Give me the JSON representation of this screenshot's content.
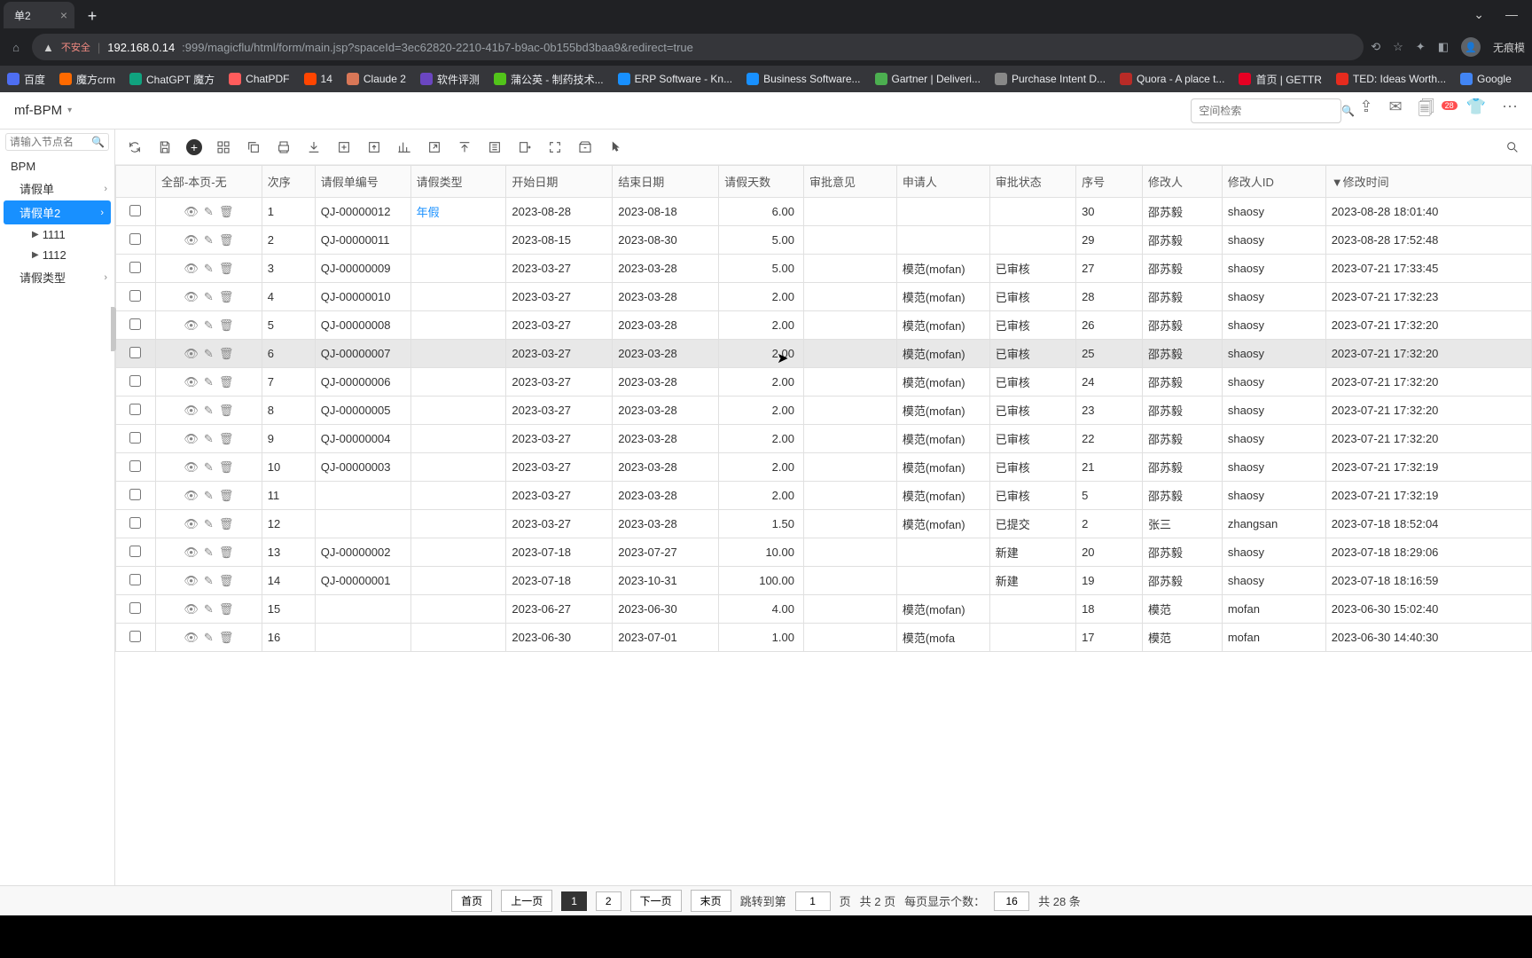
{
  "browser": {
    "tab_title": "单2",
    "url_warning": "不安全",
    "url_host": "192.168.0.14",
    "url_rest": ":999/magicflu/html/form/main.jsp?spaceId=3ec62820-2210-41b7-b9ac-0b155bd3baa9&redirect=true",
    "profile": "无痕模",
    "bookmarks": [
      {
        "label": "百度",
        "color": "#4e6ef2"
      },
      {
        "label": "魔方crm",
        "color": "#ff6a00"
      },
      {
        "label": "ChatGPT 魔方",
        "color": "#10a37f"
      },
      {
        "label": "ChatPDF",
        "color": "#ff5c5c"
      },
      {
        "label": "14",
        "color": "#ff4500"
      },
      {
        "label": "Claude 2",
        "color": "#d97757"
      },
      {
        "label": "软件评测",
        "color": "#6b46c1"
      },
      {
        "label": "蒲公英 - 制药技术...",
        "color": "#52c41a"
      },
      {
        "label": "ERP Software - Kn...",
        "color": "#1890ff"
      },
      {
        "label": "Business Software...",
        "color": "#1890ff"
      },
      {
        "label": "Gartner | Deliveri...",
        "color": "#4caf50"
      },
      {
        "label": "Purchase Intent D...",
        "color": "#888"
      },
      {
        "label": "Quora - A place t...",
        "color": "#b92b27"
      },
      {
        "label": "首页 | GETTR",
        "color": "#e60023"
      },
      {
        "label": "TED: Ideas Worth...",
        "color": "#e62b1e"
      },
      {
        "label": "Google",
        "color": "#4285f4"
      }
    ]
  },
  "app": {
    "title": "mf-BPM",
    "search_placeholder": "空间检索",
    "notif_badge": "28"
  },
  "sidebar": {
    "search_placeholder": "请输入节点名",
    "root": "BPM",
    "nodes": {
      "leave": "请假单",
      "leave2": "请假单2",
      "n1111": "1111",
      "n1112": "1112",
      "leave_type": "请假类型"
    }
  },
  "table": {
    "header": {
      "all": "全部-本页-无",
      "seq": "次序",
      "id": "请假单编号",
      "type": "请假类型",
      "start": "开始日期",
      "end": "结束日期",
      "days": "请假天数",
      "opinion": "审批意见",
      "applicant": "申请人",
      "status": "审批状态",
      "num": "序号",
      "modifier": "修改人",
      "modifier_id": "修改人ID",
      "modtime": "修改时间",
      "modtime_arrow": "▼"
    },
    "rows": [
      {
        "seq": "1",
        "id": "QJ-00000012",
        "type": "年假",
        "type_link": true,
        "start": "2023-08-28",
        "end": "2023-08-18",
        "days": "6.00",
        "applicant": "",
        "status": "",
        "num": "30",
        "modifier": "邵苏毅",
        "mid": "shaosy",
        "mtime": "2023-08-28 18:01:40"
      },
      {
        "seq": "2",
        "id": "QJ-00000011",
        "type": "",
        "start": "2023-08-15",
        "end": "2023-08-30",
        "days": "5.00",
        "applicant": "",
        "status": "",
        "num": "29",
        "modifier": "邵苏毅",
        "mid": "shaosy",
        "mtime": "2023-08-28 17:52:48"
      },
      {
        "seq": "3",
        "id": "QJ-00000009",
        "type": "",
        "start": "2023-03-27",
        "end": "2023-03-28",
        "days": "5.00",
        "applicant": "模范(mofan)",
        "status": "已审核",
        "num": "27",
        "modifier": "邵苏毅",
        "mid": "shaosy",
        "mtime": "2023-07-21 17:33:45"
      },
      {
        "seq": "4",
        "id": "QJ-00000010",
        "type": "",
        "start": "2023-03-27",
        "end": "2023-03-28",
        "days": "2.00",
        "applicant": "模范(mofan)",
        "status": "已审核",
        "num": "28",
        "modifier": "邵苏毅",
        "mid": "shaosy",
        "mtime": "2023-07-21 17:32:23"
      },
      {
        "seq": "5",
        "id": "QJ-00000008",
        "type": "",
        "start": "2023-03-27",
        "end": "2023-03-28",
        "days": "2.00",
        "applicant": "模范(mofan)",
        "status": "已审核",
        "num": "26",
        "modifier": "邵苏毅",
        "mid": "shaosy",
        "mtime": "2023-07-21 17:32:20"
      },
      {
        "seq": "6",
        "id": "QJ-00000007",
        "type": "",
        "start": "2023-03-27",
        "end": "2023-03-28",
        "days": "2.00",
        "applicant": "模范(mofan)",
        "status": "已审核",
        "num": "25",
        "modifier": "邵苏毅",
        "mid": "shaosy",
        "mtime": "2023-07-21 17:32:20",
        "highlight": true
      },
      {
        "seq": "7",
        "id": "QJ-00000006",
        "type": "",
        "start": "2023-03-27",
        "end": "2023-03-28",
        "days": "2.00",
        "applicant": "模范(mofan)",
        "status": "已审核",
        "num": "24",
        "modifier": "邵苏毅",
        "mid": "shaosy",
        "mtime": "2023-07-21 17:32:20"
      },
      {
        "seq": "8",
        "id": "QJ-00000005",
        "type": "",
        "start": "2023-03-27",
        "end": "2023-03-28",
        "days": "2.00",
        "applicant": "模范(mofan)",
        "status": "已审核",
        "num": "23",
        "modifier": "邵苏毅",
        "mid": "shaosy",
        "mtime": "2023-07-21 17:32:20"
      },
      {
        "seq": "9",
        "id": "QJ-00000004",
        "type": "",
        "start": "2023-03-27",
        "end": "2023-03-28",
        "days": "2.00",
        "applicant": "模范(mofan)",
        "status": "已审核",
        "num": "22",
        "modifier": "邵苏毅",
        "mid": "shaosy",
        "mtime": "2023-07-21 17:32:20"
      },
      {
        "seq": "10",
        "id": "QJ-00000003",
        "type": "",
        "start": "2023-03-27",
        "end": "2023-03-28",
        "days": "2.00",
        "applicant": "模范(mofan)",
        "status": "已审核",
        "num": "21",
        "modifier": "邵苏毅",
        "mid": "shaosy",
        "mtime": "2023-07-21 17:32:19"
      },
      {
        "seq": "11",
        "id": "",
        "type": "",
        "start": "2023-03-27",
        "end": "2023-03-28",
        "days": "2.00",
        "applicant": "模范(mofan)",
        "status": "已审核",
        "num": "5",
        "modifier": "邵苏毅",
        "mid": "shaosy",
        "mtime": "2023-07-21 17:32:19"
      },
      {
        "seq": "12",
        "id": "",
        "type": "",
        "start": "2023-03-27",
        "end": "2023-03-28",
        "days": "1.50",
        "applicant": "模范(mofan)",
        "status": "已提交",
        "num": "2",
        "modifier": "张三",
        "mid": "zhangsan",
        "mtime": "2023-07-18 18:52:04"
      },
      {
        "seq": "13",
        "id": "QJ-00000002",
        "type": "",
        "start": "2023-07-18",
        "end": "2023-07-27",
        "days": "10.00",
        "applicant": "",
        "status": "新建",
        "num": "20",
        "modifier": "邵苏毅",
        "mid": "shaosy",
        "mtime": "2023-07-18 18:29:06"
      },
      {
        "seq": "14",
        "id": "QJ-00000001",
        "type": "",
        "start": "2023-07-18",
        "end": "2023-10-31",
        "days": "100.00",
        "applicant": "",
        "status": "新建",
        "num": "19",
        "modifier": "邵苏毅",
        "mid": "shaosy",
        "mtime": "2023-07-18 18:16:59"
      },
      {
        "seq": "15",
        "id": "",
        "type": "",
        "start": "2023-06-27",
        "end": "2023-06-30",
        "days": "4.00",
        "applicant": "模范(mofan)",
        "status": "",
        "num": "18",
        "modifier": "模范",
        "mid": "mofan",
        "mtime": "2023-06-30 15:02:40"
      },
      {
        "seq": "16",
        "id": "",
        "type": "",
        "start": "2023-06-30",
        "end": "2023-07-01",
        "days": "1.00",
        "applicant": "模范(mofa",
        "status": "",
        "num": "17",
        "modifier": "模范",
        "mid": "mofan",
        "mtime": "2023-06-30 14:40:30"
      }
    ]
  },
  "pagination": {
    "first": "首页",
    "prev": "上一页",
    "p1": "1",
    "p2": "2",
    "next": "下一页",
    "last": "末页",
    "jump_label": "跳转到第",
    "jump_value": "1",
    "page_suffix": "页",
    "total_pages": "共 2 页",
    "per_page_label": "每页显示个数：",
    "per_page_value": "16",
    "total_items": "共 28 条"
  }
}
